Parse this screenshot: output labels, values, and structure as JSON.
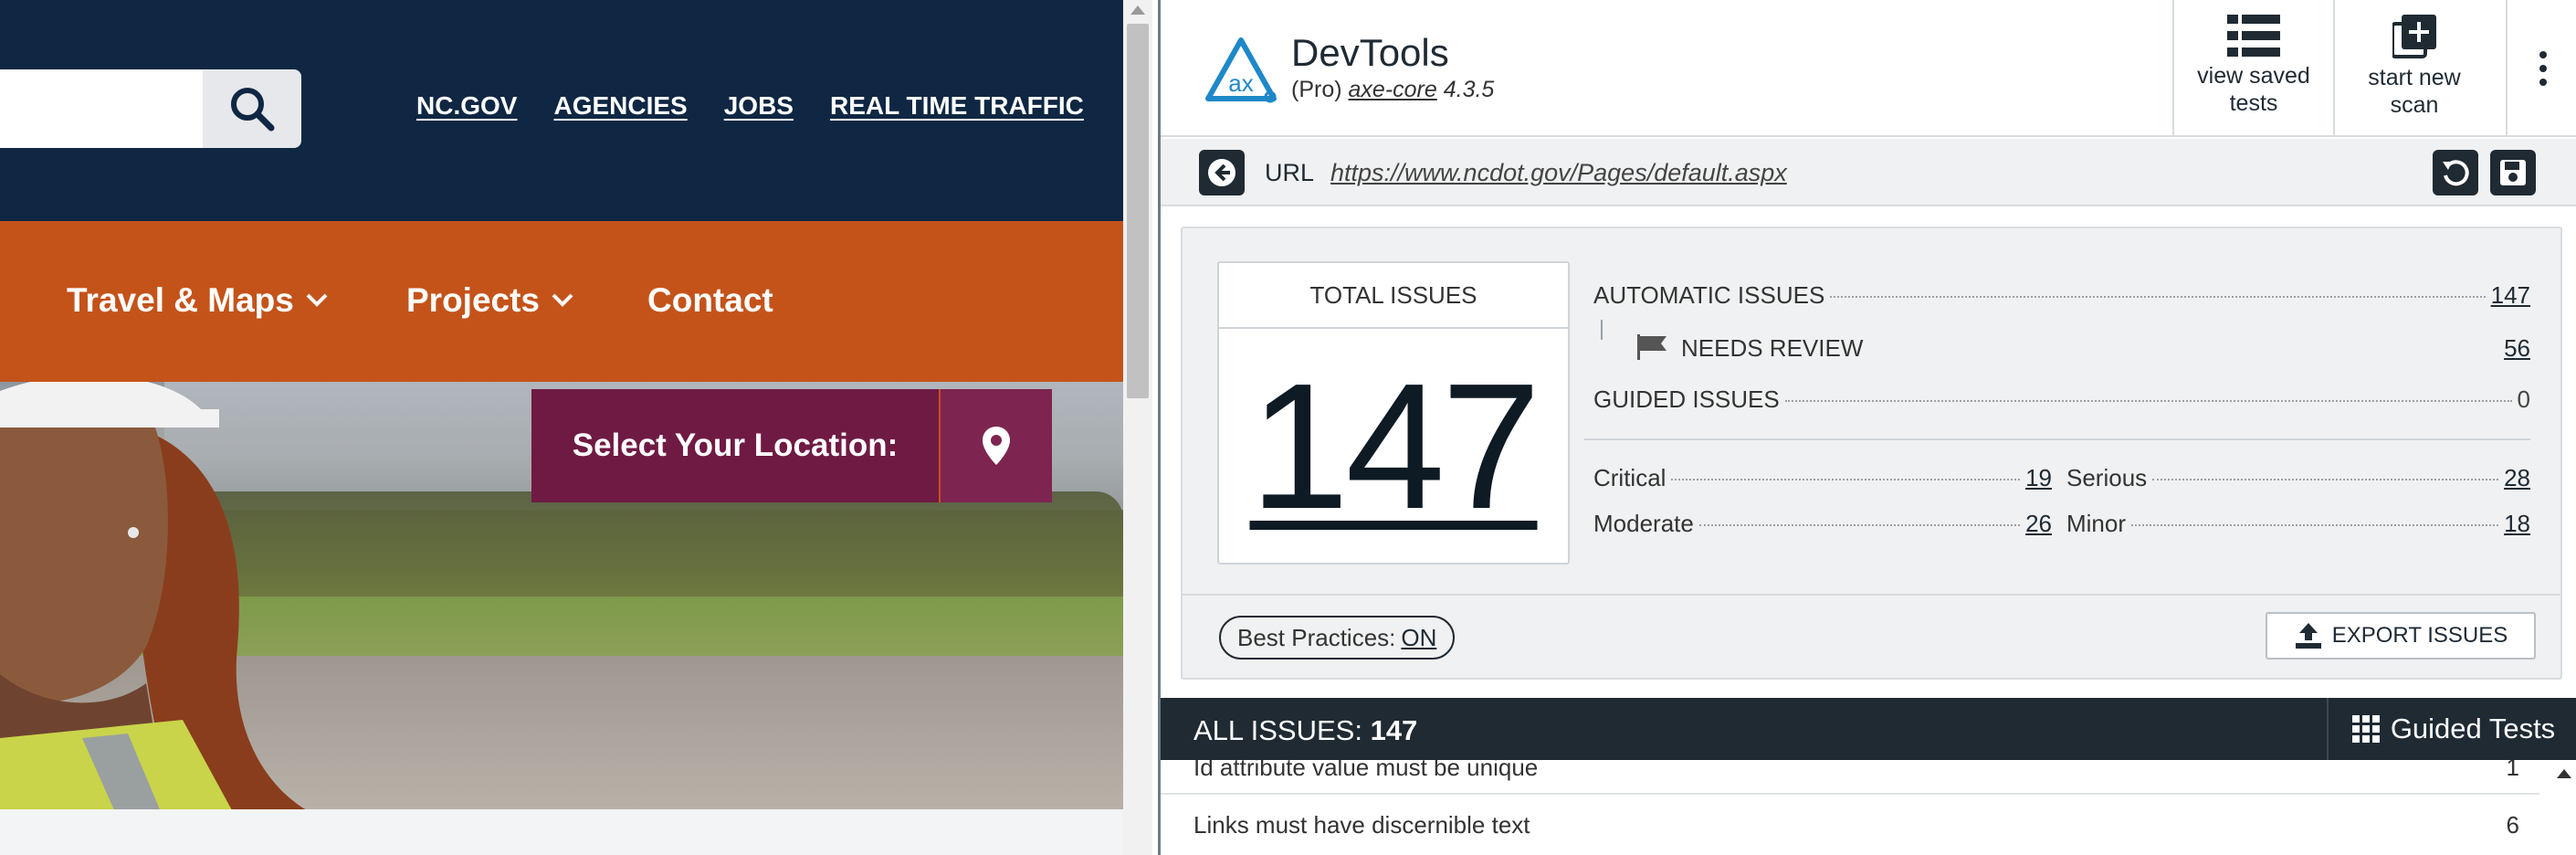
{
  "website": {
    "top_links": [
      "NC.GOV",
      "AGENCIES",
      "JOBS",
      "REAL TIME TRAFFIC"
    ],
    "nav": {
      "travel_maps": "Travel & Maps",
      "projects": "Projects",
      "contact": "Contact"
    },
    "location_button": "Select Your Location:",
    "colors": {
      "header_bg": "#0f2743",
      "nav_bg": "#c4531a",
      "location_bg": "#6f1a43"
    }
  },
  "devtools": {
    "title": "DevTools",
    "subtitle_prefix": "(Pro)",
    "subtitle_core": "axe-core",
    "subtitle_version": "4.3.5",
    "header_buttons": {
      "view_saved": "view saved tests",
      "start_new": "start new scan"
    },
    "url_label": "URL",
    "url": "https://www.ncdot.gov/Pages/default.aspx",
    "summary": {
      "total_title": "TOTAL ISSUES",
      "total": "147",
      "automatic_label": "AUTOMATIC ISSUES",
      "automatic_value": "147",
      "needs_review_label": "NEEDS REVIEW",
      "needs_review_value": "56",
      "guided_label": "GUIDED ISSUES",
      "guided_value": "0",
      "critical_label": "Critical",
      "critical_value": "19",
      "serious_label": "Serious",
      "serious_value": "28",
      "moderate_label": "Moderate",
      "moderate_value": "26",
      "minor_label": "Minor",
      "minor_value": "18"
    },
    "best_practices_label": "Best Practices:",
    "best_practices_state": "ON",
    "export_label": "EXPORT ISSUES",
    "all_issues_label": "ALL ISSUES:",
    "all_issues_count": "147",
    "guided_tests_label": "Guided Tests",
    "issues": [
      {
        "label": "Id attribute value must be unique",
        "count": "1"
      },
      {
        "label": "Links must have discernible text",
        "count": "6"
      }
    ]
  }
}
